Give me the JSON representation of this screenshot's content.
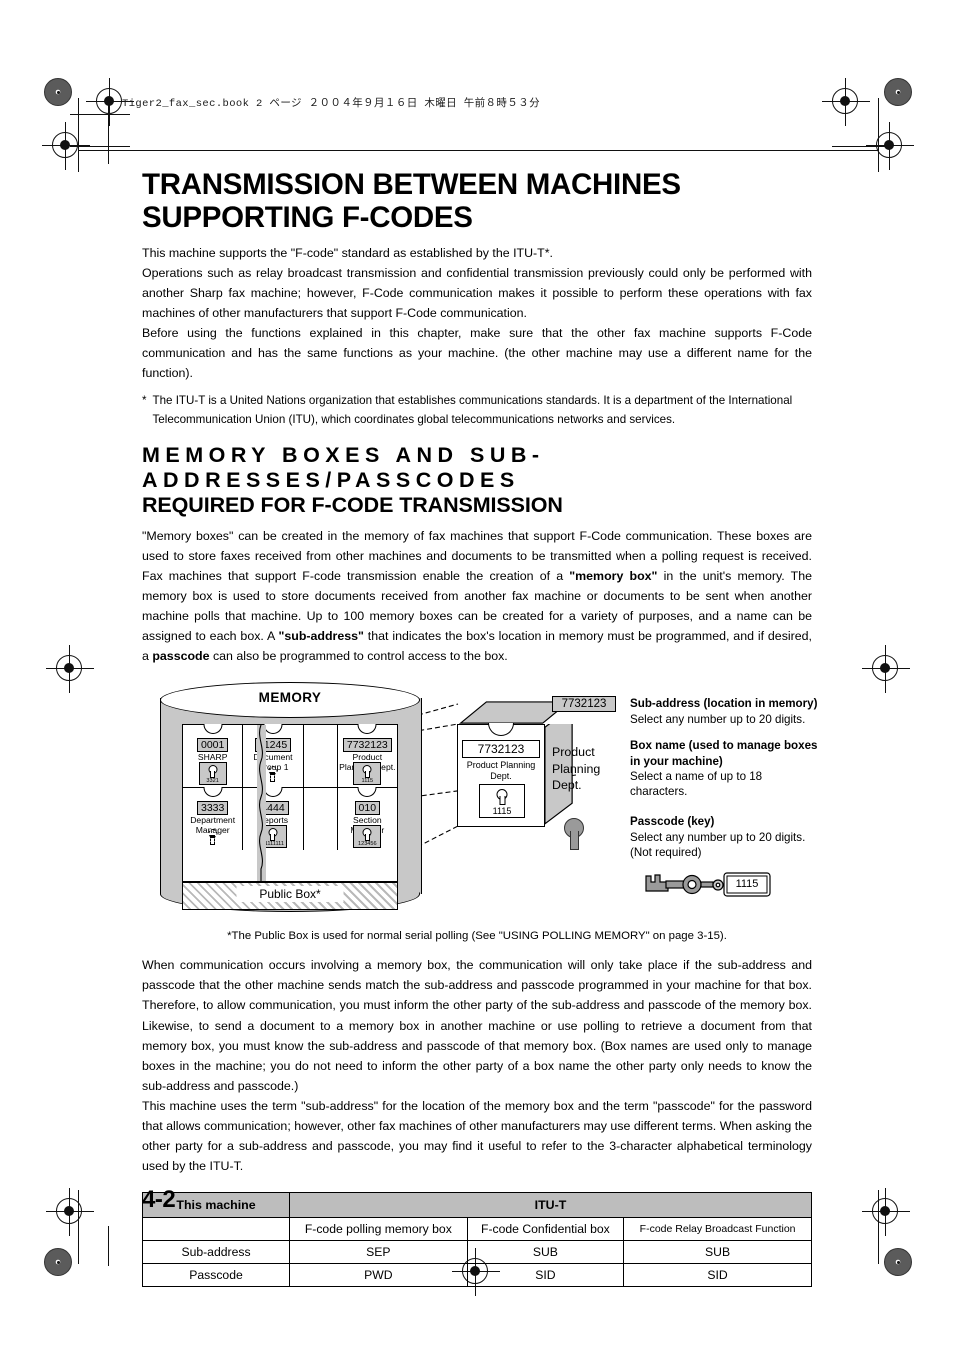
{
  "header": {
    "slug": "Tiger2_fax_sec.book   2 ページ   ２００４年９月１６日   木曜日   午前８時５３分"
  },
  "page": {
    "number": "4-2"
  },
  "title": "TRANSMISSION BETWEEN MACHINES SUPPORTING F-CODES",
  "intro": {
    "p1": "This machine supports the \"F-code\" standard as established by the ITU-T*.",
    "p2": "Operations such as relay broadcast transmission and confidential transmission previously could only be performed with another Sharp fax machine; however, F-Code communication makes it possible to perform these operations with fax machines of other manufacturers that support F-Code communication.",
    "p3": "Before using the functions explained in this chapter, make sure that the other fax machine supports F-Code communication and has the same functions as your machine. (the other machine may use a different name for the function).",
    "footnote_marker": "*",
    "footnote": "The ITU-T is a United Nations organization that establishes communications standards. It is a department of the International Telecommunication Union (ITU), which coordinates global telecommunications networks and services."
  },
  "section": {
    "heading_line1": "MEMORY BOXES AND SUB-ADDRESSES/PASSCODES",
    "heading_line2": "REQUIRED FOR F-CODE TRANSMISSION",
    "para1_a": "\"Memory boxes\" can be created in the memory of fax machines that support F-Code communication. These boxes are used to store faxes received from other machines and documents to be transmitted when a polling request is received. Fax machines that support F-code transmission enable the creation of a ",
    "para1_b": "\"memory box\"",
    "para1_c": " in the unit's memory. The memory box is used to store documents received from another fax machine or documents to be sent when another machine polls that machine. Up to 100 memory boxes can be created for a variety of purposes, and a name can be assigned to each box. A ",
    "para1_d": "\"sub-address\"",
    "para1_e": " that indicates the box's location in memory must be programmed, and if desired, a ",
    "para1_f": "passcode",
    "para1_g": " can also be programmed to control access to the box."
  },
  "figure": {
    "memory_label": "MEMORY",
    "public_box_label": "Public Box*",
    "boxes": [
      {
        "number": "0001",
        "name": "SHARP",
        "passcode": "3321",
        "has_passcode": true
      },
      {
        "number": "11245",
        "name": "Document Group 1",
        "passcode": "",
        "has_passcode": false
      },
      {
        "number": "7732123",
        "name": "Product Planning Dept.",
        "passcode": "1115",
        "has_passcode": true
      },
      {
        "number": "3333",
        "name": "Department Manager",
        "passcode": "",
        "has_passcode": false
      },
      {
        "number": "4444",
        "name": "Reports",
        "passcode": "11111111",
        "has_passcode": true
      },
      {
        "number": "010",
        "name": "Section Manager",
        "passcode": "123456",
        "has_passcode": true
      }
    ],
    "exploded": {
      "number": "7732123",
      "name": "Product Planning Dept.",
      "passcode": "1115"
    },
    "legend": {
      "chip_number": "7732123",
      "chip_name": "Product Planning Dept.",
      "key_tag": "1115",
      "items": [
        {
          "heading": "Sub-address (location in memory)",
          "detail": "Select any number up to 20 digits."
        },
        {
          "heading": "Box name (used to manage boxes in your machine)",
          "detail": "Select a name of up to 18 characters."
        },
        {
          "heading": "Passcode (key)",
          "detail": "Select any number up to 20 digits. (Not required)"
        }
      ]
    },
    "caption": "*The Public Box is used for normal serial polling (See \"USING POLLING MEMORY\" on page 3-15)."
  },
  "after": {
    "p1": "When communication occurs involving a memory box, the communication will only take place if the sub-address and passcode that the other machine sends match the sub-address and passcode programmed in your machine for that box. Therefore, to allow communication, you must inform the other party of the sub-address and passcode of the memory box. Likewise, to send a document to a memory box in another machine or use polling to retrieve a document from that memory box, you must know the sub-address and passcode of that memory box. (Box names are used only to manage boxes in the machine; you do not need to inform the other party of a box name the other party only needs to know the sub-address and passcode.)",
    "p2": "This machine uses the term \"sub-address\" for the location of the memory box and the term \"passcode\" for the password that allows communication; however, other fax machines of other manufacturers may use different terms. When asking the other party for a sub-address and passcode, you may find it useful to refer to the 3-character alphabetical terminology used by the ITU-T."
  },
  "table": {
    "header_left": "This machine",
    "header_right": "ITU-T",
    "subheaders": [
      "",
      "F-code polling memory box",
      "F-code Confidential box",
      "F-code Relay Broadcast Function"
    ],
    "rows": [
      {
        "label": "Sub-address",
        "values": [
          "SEP",
          "SUB",
          "SUB"
        ]
      },
      {
        "label": "Passcode",
        "values": [
          "PWD",
          "SID",
          "SID"
        ]
      }
    ]
  }
}
